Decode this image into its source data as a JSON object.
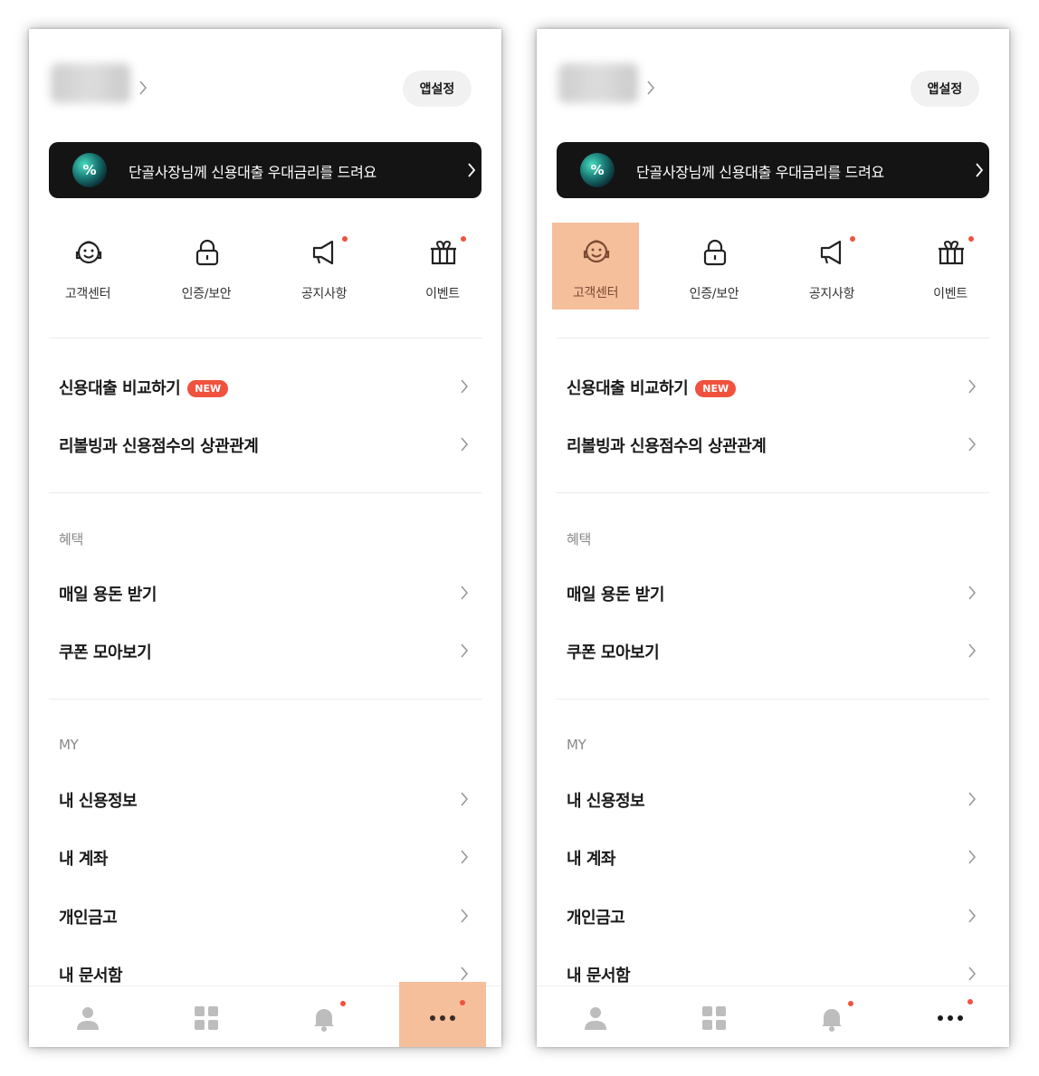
{
  "colors": {
    "accent_highlight": "#f5bf9c",
    "badge_red": "#f0523e",
    "banner_bg": "#141414"
  },
  "screens": [
    {
      "highlight": "more-tab",
      "header": {
        "app_settings": "앱설정"
      },
      "banner": {
        "logo_glyph": "%",
        "text": "단골사장님께 신용대출 우대금리를 드려요"
      },
      "quick_menu": [
        {
          "label": "고객센터",
          "icon": "headset-smile-icon"
        },
        {
          "label": "인증/보안",
          "icon": "lock-icon"
        },
        {
          "label": "공지사항",
          "icon": "megaphone-icon"
        },
        {
          "label": "이벤트",
          "icon": "gift-icon"
        }
      ],
      "promo_items": [
        {
          "label": "신용대출 비교하기",
          "badge": "NEW"
        },
        {
          "label": "리볼빙과 신용점수의 상관관계"
        }
      ],
      "benefits": {
        "title": "혜택",
        "items": [
          "매일 용돈 받기",
          "쿠폰 모아보기"
        ]
      },
      "my": {
        "title": "MY",
        "items": [
          "내 신용정보",
          "내 계좌",
          "개인금고",
          "내 문서함"
        ]
      },
      "tabbar": [
        "person-icon",
        "grid-icon",
        "bell-icon",
        "more-dots-icon"
      ]
    },
    {
      "highlight": "customer-center",
      "header": {
        "app_settings": "앱설정"
      },
      "banner": {
        "logo_glyph": "%",
        "text": "단골사장님께 신용대출 우대금리를 드려요"
      },
      "quick_menu": [
        {
          "label": "고객센터",
          "icon": "headset-smile-icon"
        },
        {
          "label": "인증/보안",
          "icon": "lock-icon"
        },
        {
          "label": "공지사항",
          "icon": "megaphone-icon"
        },
        {
          "label": "이벤트",
          "icon": "gift-icon"
        }
      ],
      "promo_items": [
        {
          "label": "신용대출 비교하기",
          "badge": "NEW"
        },
        {
          "label": "리볼빙과 신용점수의 상관관계"
        }
      ],
      "benefits": {
        "title": "혜택",
        "items": [
          "매일 용돈 받기",
          "쿠폰 모아보기"
        ]
      },
      "my": {
        "title": "MY",
        "items": [
          "내 신용정보",
          "내 계좌",
          "개인금고",
          "내 문서함"
        ]
      },
      "tabbar": [
        "person-icon",
        "grid-icon",
        "bell-icon",
        "more-dots-icon"
      ]
    }
  ]
}
